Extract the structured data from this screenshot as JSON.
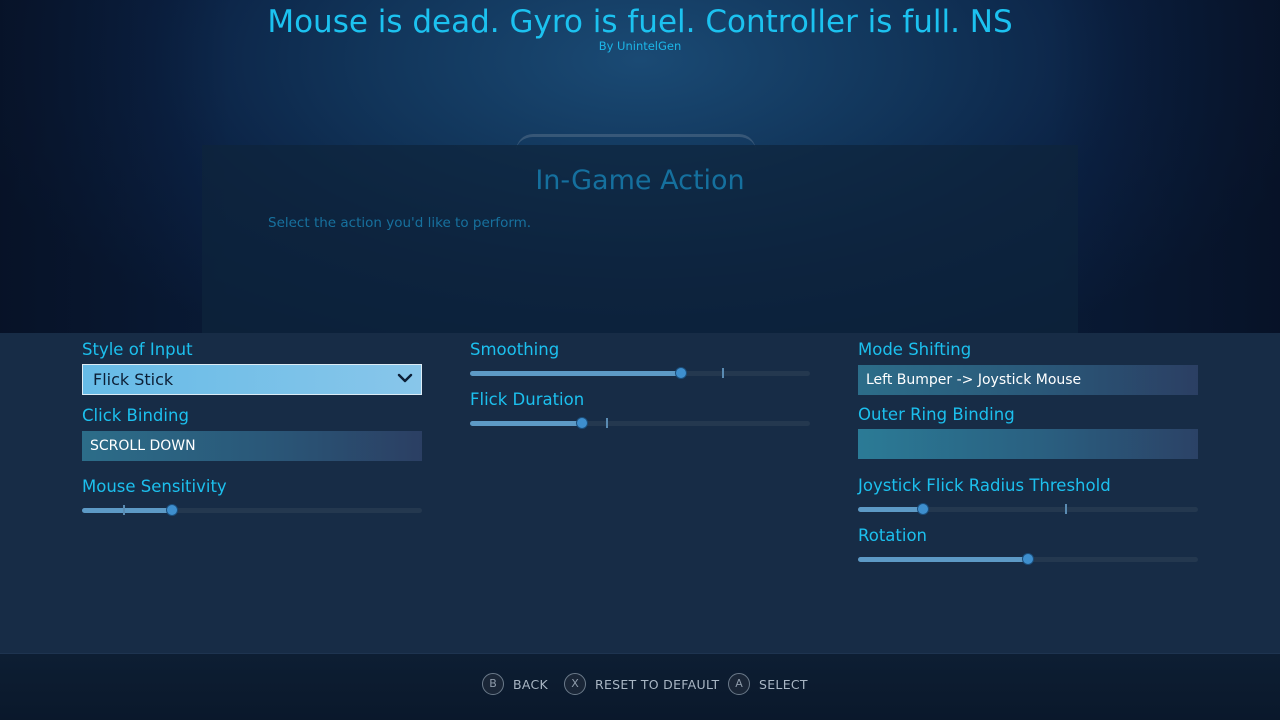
{
  "header": {
    "title": "Mouse is dead. Gyro is fuel. Controller is full. NS",
    "subtitle": "By UnintelGen"
  },
  "dialog": {
    "title": "In-Game Action",
    "description": "Select the action you'd like to perform."
  },
  "settings": {
    "style_of_input": {
      "label": "Style of Input",
      "value": "Flick Stick"
    },
    "click_binding": {
      "label": "Click Binding",
      "value": "SCROLL DOWN"
    },
    "mouse_sensitivity": {
      "label": "Mouse Sensitivity",
      "fraction": 0.265,
      "default_fraction": 0.12
    },
    "smoothing": {
      "label": "Smoothing",
      "fraction": 0.62,
      "default_fraction": 0.74
    },
    "flick_duration": {
      "label": "Flick Duration",
      "fraction": 0.33,
      "default_fraction": 0.4
    },
    "mode_shifting": {
      "label": "Mode Shifting",
      "value": "Left Bumper -> Joystick Mouse"
    },
    "outer_ring_binding": {
      "label": "Outer Ring Binding",
      "value": ""
    },
    "joystick_flick_radius_threshold": {
      "label": "Joystick Flick Radius Threshold",
      "fraction": 0.19,
      "default_fraction": 0.61
    },
    "rotation": {
      "label": "Rotation",
      "fraction": 0.5
    }
  },
  "footer": {
    "back": {
      "button": "B",
      "label": "BACK"
    },
    "reset": {
      "button": "X",
      "label": "RESET TO DEFAULT"
    },
    "select": {
      "button": "A",
      "label": "SELECT"
    }
  },
  "colors": {
    "accent": "#1cc0ee",
    "panel": "#172c46",
    "slider_fill": "#5d9ac6",
    "slider_thumb": "#3e8fce"
  }
}
